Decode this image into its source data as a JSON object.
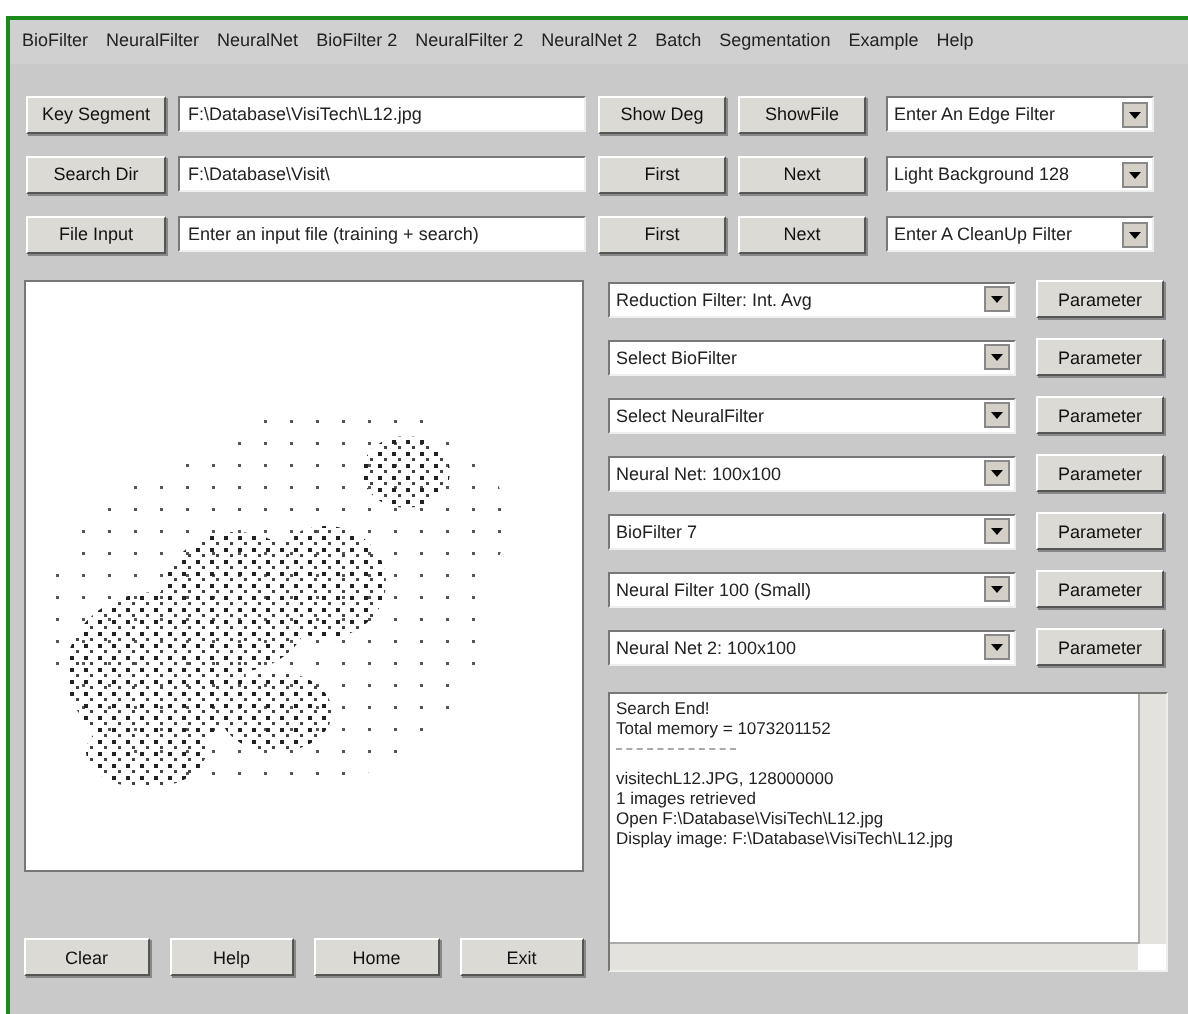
{
  "menu": [
    "BioFilter",
    "NeuralFilter",
    "NeuralNet",
    "BioFilter 2",
    "NeuralFilter 2",
    "NeuralNet 2",
    "Batch",
    "Segmentation",
    "Example",
    "Help"
  ],
  "rows": [
    {
      "button": "Key Segment",
      "field": "F:\\Database\\VisiTech\\L12.jpg",
      "buttons": [
        "Show Deg",
        "ShowFile"
      ],
      "select": "Enter An Edge Filter"
    },
    {
      "button": "Search Dir",
      "field": "F:\\Database\\Visit\\",
      "buttons": [
        "First",
        "Next"
      ],
      "select": "Light Background 128"
    },
    {
      "button": "File Input",
      "field": "Enter an input file (training + search)",
      "buttons": [
        "First",
        "Next"
      ],
      "select": "Enter A CleanUp Filter"
    }
  ],
  "filters": [
    {
      "select": "Reduction Filter: Int. Avg",
      "button": "Parameter"
    },
    {
      "select": "Select BioFilter",
      "button": "Parameter"
    },
    {
      "select": "Select NeuralFilter",
      "button": "Parameter"
    },
    {
      "select": "Neural Net: 100x100",
      "button": "Parameter"
    },
    {
      "select": "BioFilter 7",
      "button": "Parameter"
    },
    {
      "select": "Neural Filter 100 (Small)",
      "button": "Parameter"
    },
    {
      "select": "Neural Net 2: 100x100",
      "button": "Parameter"
    }
  ],
  "log": [
    {
      "kind": "text",
      "text": "Search End!"
    },
    {
      "kind": "text",
      "text": "Total memory = 1073201152"
    },
    {
      "kind": "separator"
    },
    {
      "kind": "text",
      "text": "visitechL12.JPG, 128000000"
    },
    {
      "kind": "text",
      "text": "1 images retrieved"
    },
    {
      "kind": "text",
      "text": "Open F:\\Database\\VisiTech\\L12.jpg"
    },
    {
      "kind": "text",
      "text": "Display image: F:\\Database\\VisiTech\\L12.jpg"
    }
  ],
  "bottom_buttons": [
    "Clear",
    "Help",
    "Home",
    "Exit"
  ]
}
